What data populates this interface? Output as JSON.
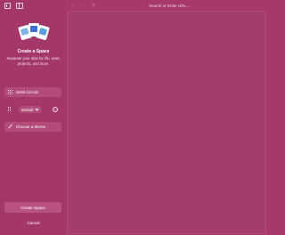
{
  "sidebar": {
    "title": "Create a Space",
    "description": "Separate your tabs for life, work, projects, and more.",
    "name_value": "Geek Circuit",
    "profile_value": "Default",
    "theme_label": "Choose a theme",
    "create_button_label": "Create Space",
    "cancel_label": "Cancel"
  },
  "toolbar": {
    "url_placeholder": "Search or Enter URL..."
  },
  "colors": {
    "accent": "#a6396a",
    "sidebar_bg": "#a3376a",
    "field_bg": "#b24b7a"
  }
}
